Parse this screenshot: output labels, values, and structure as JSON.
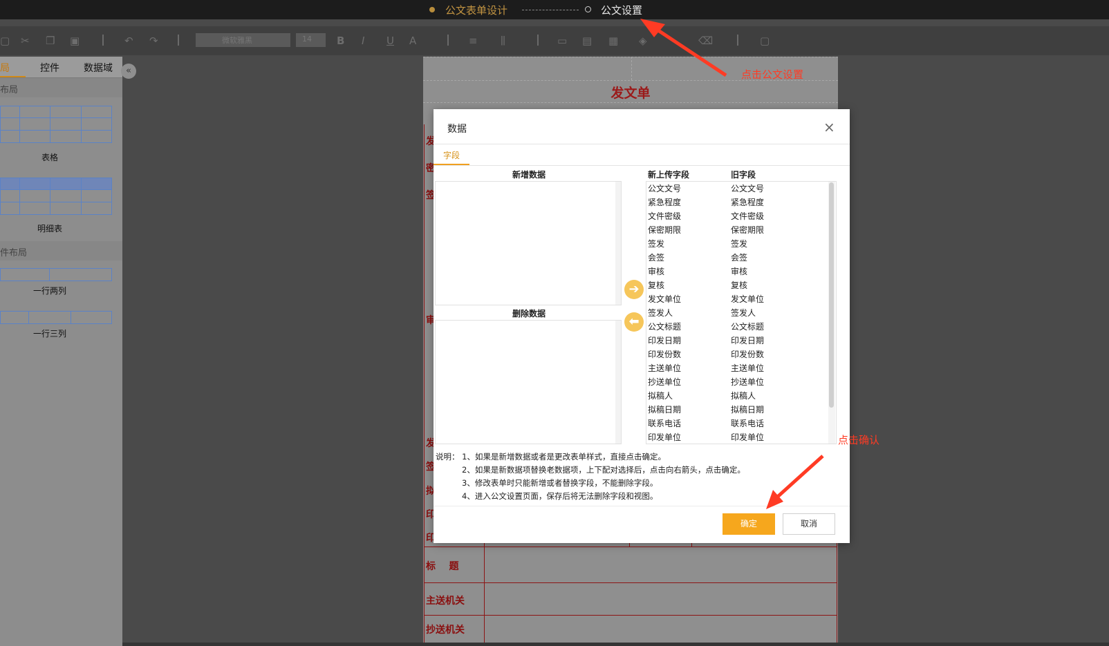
{
  "header": {
    "steps": [
      {
        "label": "公文表单设计",
        "state": "done"
      },
      {
        "label": "公文设置",
        "state": "pending"
      }
    ]
  },
  "toolbar": {
    "font": "微软雅黑",
    "size": "14",
    "icons": [
      "save-icon",
      "cut-icon",
      "copy-icon",
      "paste-icon",
      "undo-icon",
      "redo-icon",
      "bold-icon",
      "italic-icon",
      "underline-icon",
      "font-color-icon",
      "align-icon",
      "valign-icon",
      "merge-icon",
      "split-icon",
      "border-icon",
      "fill-icon",
      "clear-icon",
      "preview-icon"
    ]
  },
  "left_panel": {
    "tabs": [
      "局",
      "控件",
      "数据域"
    ],
    "active_tab": 0,
    "sections": [
      "布局",
      "件布局"
    ],
    "items": [
      "表格",
      "明细表",
      "一行两列",
      "一行三列"
    ],
    "collapse_icon": "«"
  },
  "form": {
    "title": "发文单",
    "labels_left": [
      "发",
      "密",
      "签",
      "审",
      "发",
      "签",
      "拟",
      "印",
      "印"
    ],
    "labels_bottom": [
      "标    题",
      "主送机关",
      "抄送机关"
    ]
  },
  "dialog": {
    "title": "数据",
    "close": "×",
    "tab": "字段",
    "new_data_label": "新增数据",
    "delete_data_label": "删除数据",
    "new_field_header": "新上传字段",
    "old_field_header": "旧字段",
    "arrow_right": "➔",
    "arrow_left": "⬅",
    "fields": [
      [
        "公文文号",
        "公文文号"
      ],
      [
        "紧急程度",
        "紧急程度"
      ],
      [
        "文件密级",
        "文件密级"
      ],
      [
        "保密期限",
        "保密期限"
      ],
      [
        "签发",
        "签发"
      ],
      [
        "会签",
        "会签"
      ],
      [
        "审核",
        "审核"
      ],
      [
        "复核",
        "复核"
      ],
      [
        "发文单位",
        "发文单位"
      ],
      [
        "签发人",
        "签发人"
      ],
      [
        "公文标题",
        "公文标题"
      ],
      [
        "印发日期",
        "印发日期"
      ],
      [
        "印发份数",
        "印发份数"
      ],
      [
        "主送单位",
        "主送单位"
      ],
      [
        "抄送单位",
        "抄送单位"
      ],
      [
        "拟稿人",
        "拟稿人"
      ],
      [
        "拟稿日期",
        "拟稿日期"
      ],
      [
        "联系电话",
        "联系电话"
      ],
      [
        "印发单位",
        "印发单位"
      ]
    ],
    "notes": [
      "说明：  1、如果是新增数据或者是更改表单样式，直接点击确定。",
      "2、如果是新数据项替换老数据项，上下配对选择后，点击向右箭头，点击确定。",
      "3、修改表单时只能新增或者替换字段，不能删除字段。",
      "4、进入公文设置页面，保存后将无法删除字段和视图。"
    ],
    "ok_label": "确定",
    "cancel_label": "取消"
  },
  "annotations": {
    "top": "点击公文设置",
    "bottom": "点击确认",
    "color": "#ff3b24"
  }
}
